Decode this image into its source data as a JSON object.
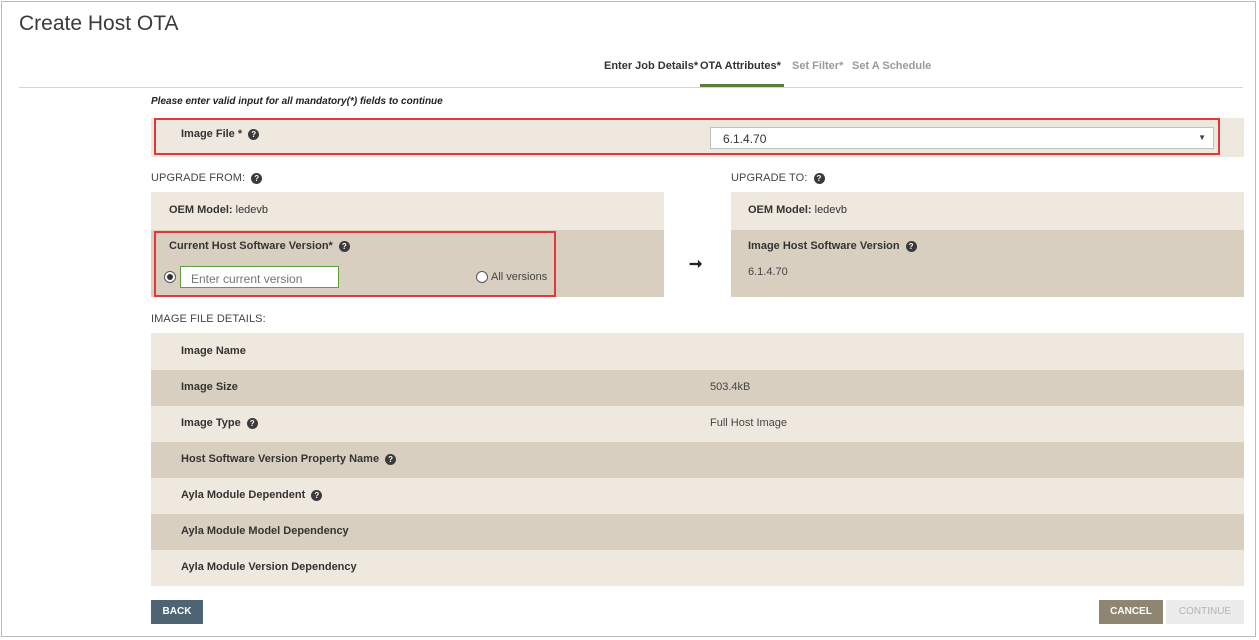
{
  "page": {
    "title": "Create Host OTA"
  },
  "steps": [
    {
      "label": "Enter Job Details*",
      "state": "done"
    },
    {
      "label": "OTA Attributes*",
      "state": "active"
    },
    {
      "label": "Set Filter*",
      "state": "inactive"
    },
    {
      "label": "Set A Schedule",
      "state": "inactive"
    }
  ],
  "notice": "Please enter valid input for all mandatory(*) fields to continue",
  "image_file": {
    "label": "Image File *",
    "selected": "6.1.4.70"
  },
  "upgrade_from": {
    "heading": "UPGRADE FROM:",
    "oem_label": "OEM Model:",
    "oem_value": "ledevb",
    "version_label": "Current Host Software Version*",
    "version_placeholder": "Enter current version",
    "all_versions_label": "All versions"
  },
  "upgrade_to": {
    "heading": "UPGRADE TO:",
    "oem_label": "OEM Model:",
    "oem_value": "ledevb",
    "version_label": "Image Host Software Version",
    "version_value": "6.1.4.70"
  },
  "details": {
    "heading": "IMAGE FILE DETAILS:",
    "rows": [
      {
        "label": "Image Name",
        "value": "",
        "help": false
      },
      {
        "label": "Image Size",
        "value": "503.4kB",
        "help": false
      },
      {
        "label": "Image Type",
        "value": "Full Host Image",
        "help": true
      },
      {
        "label": "Host Software Version Property Name",
        "value": "",
        "help": true
      },
      {
        "label": "Ayla Module Dependent",
        "value": "",
        "help": true
      },
      {
        "label": "Ayla Module Model Dependency",
        "value": "",
        "help": false
      },
      {
        "label": "Ayla Module Version Dependency",
        "value": "",
        "help": false
      }
    ]
  },
  "buttons": {
    "back": "BACK",
    "cancel": "CANCEL",
    "continue": "CONTINUE"
  },
  "colors": {
    "accent": "#5c7d3c",
    "highlight": "#e2383a",
    "band_light": "#efe8df",
    "band_dark": "#d8cfc1"
  }
}
